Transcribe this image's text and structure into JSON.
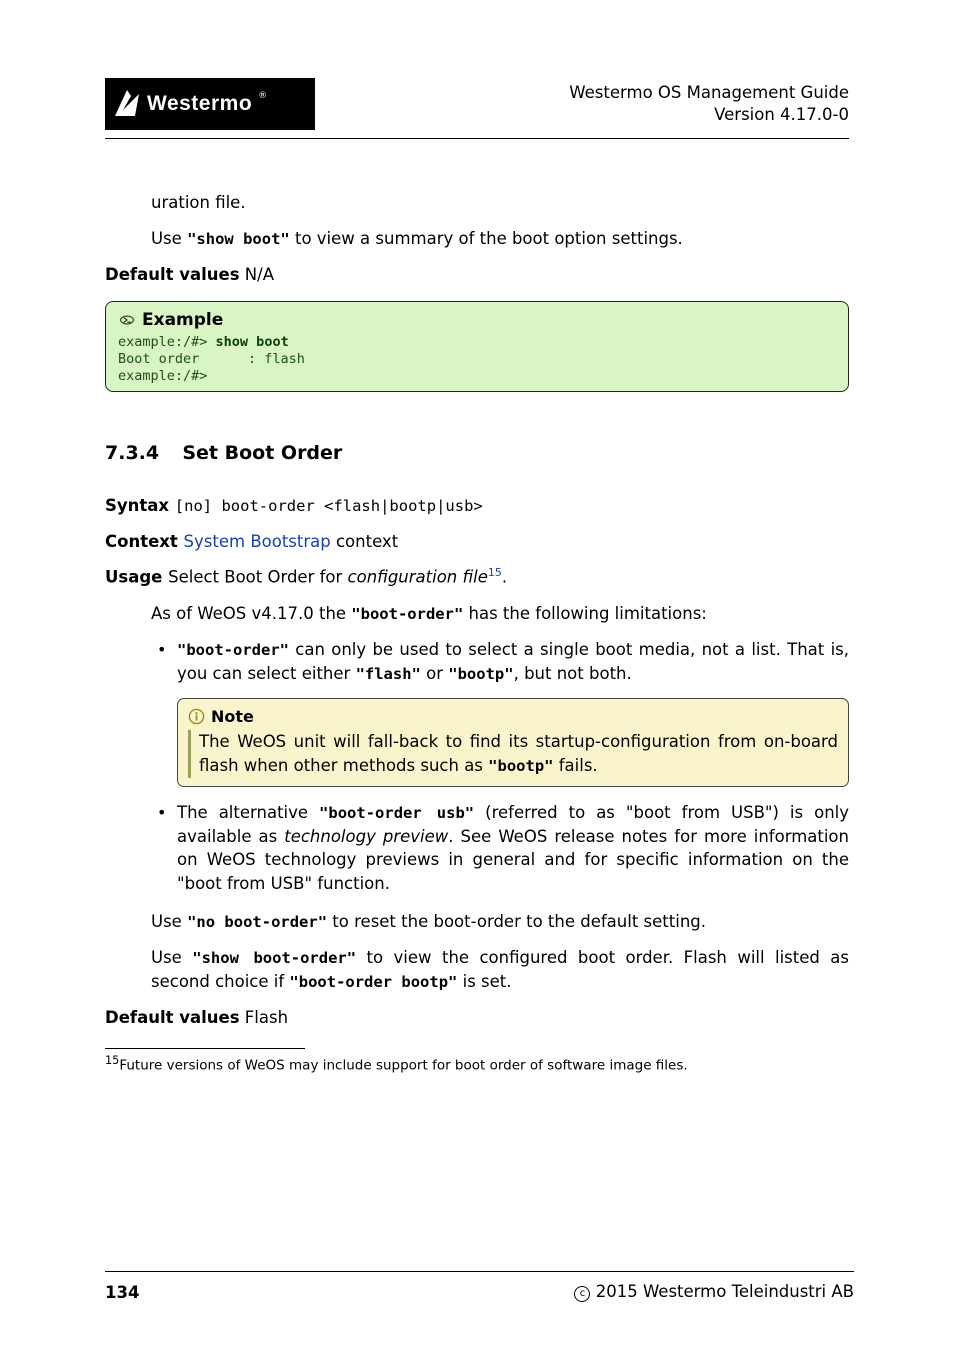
{
  "header": {
    "logo_text": "Westermo",
    "title_line1": "Westermo OS Management Guide",
    "title_line2": "Version 4.17.0-0"
  },
  "body": {
    "uration": "uration file.",
    "use_show_boot_pre": "Use ",
    "show_boot_cmd": "\"show boot\"",
    "use_show_boot_post": " to view a summary of the boot option settings.",
    "default_values_label": "Default values",
    "default_values_na": " N/A",
    "example_label": "Example",
    "example_code_line1_prompt": "example:/#> ",
    "example_code_line1_cmd": "show boot",
    "example_code_line2": "Boot order      : flash",
    "example_code_line3": "example:/#>",
    "section_num": "7.3.4",
    "section_title": "Set Boot Order",
    "syntax_label": "Syntax ",
    "syntax_value": "[no] boot-order <flash|bootp|usb>",
    "context_label": "Context ",
    "context_link": "System Bootstrap",
    "context_post": " context",
    "usage_label": "Usage ",
    "usage_text_pre": "Select Boot Order for ",
    "usage_text_italic": "configuration file",
    "usage_sup": "15",
    "usage_text_post": ".",
    "asof_pre": "As of WeOS v4.17.0 the ",
    "asof_cmd": "\"boot-order\"",
    "asof_post": " has the following limitations:",
    "li1_pre": "",
    "li1_cmd1": "\"boot-order\"",
    "li1_mid": " can only be used to select a single boot media, not a list. That is, you can select either ",
    "li1_cmd2": "\"flash\"",
    "li1_or": " or ",
    "li1_cmd3": "\"bootp\"",
    "li1_post": ", but not both.",
    "note_label": "Note",
    "note_text_pre": "The WeOS unit will fall-back to find its startup-configuration from on-board flash when other methods such as ",
    "note_cmd": "\"bootp\"",
    "note_text_post": " fails.",
    "li2_pre": "The alternative ",
    "li2_cmd": "\"boot-order usb\"",
    "li2_mid": " (referred to as \"boot from USB\") is only available as ",
    "li2_italic": "technology preview",
    "li2_post": ". See WeOS release notes for more information on WeOS technology previews in general and for specific information on the \"boot from USB\" function.",
    "use_no_pre": "Use ",
    "use_no_cmd": "\"no boot-order\"",
    "use_no_post": " to reset the boot-order to the default setting.",
    "use_show_pre": "Use ",
    "use_show_cmd": "\"show boot-order\"",
    "use_show_mid": " to view the configured boot order. Flash will listed as second choice if ",
    "use_show_cmd2": "\"boot-order bootp\"",
    "use_show_post": " is set.",
    "default_values_label2": "Default values",
    "default_values_flash": " Flash",
    "footnote_sup": "15",
    "footnote_text": "Future versions of WeOS may include support for boot order of software image files."
  },
  "footer": {
    "page_num": "134",
    "copyright": " 2015 Westermo Teleindustri AB"
  }
}
